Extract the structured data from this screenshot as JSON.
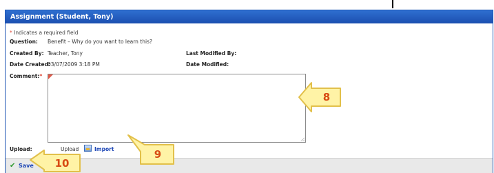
{
  "window": {
    "title": "Assignment (Student, Tony)"
  },
  "form": {
    "required_note_star": "*",
    "required_note": "Indicates a required field",
    "question_label": "Question:",
    "question_value": "Benefit – Why do you want to learn this?",
    "created_by_label": "Created By:",
    "created_by_value": "Teacher, Tony",
    "last_modified_label": "Last Modified By:",
    "date_created_label": "Date Created:",
    "date_created_value": "03/07/2009 3:18 PM",
    "date_modified_label": "Date Modified:",
    "comment_label": "Comment:",
    "comment_required_star": "*",
    "comment_value": "",
    "upload_label": "Upload:",
    "upload_link_partial": "Upload",
    "import_link": "Import"
  },
  "footer": {
    "save_label": "Save"
  },
  "callouts": [
    {
      "number": "8"
    },
    {
      "number": "9"
    },
    {
      "number": "10"
    }
  ],
  "colors": {
    "titlebar": "#1b4fb0",
    "callout_fill": "#fff3a6",
    "callout_border": "#e2c04a",
    "callout_number": "#d84a14",
    "link": "#1e47b6"
  }
}
